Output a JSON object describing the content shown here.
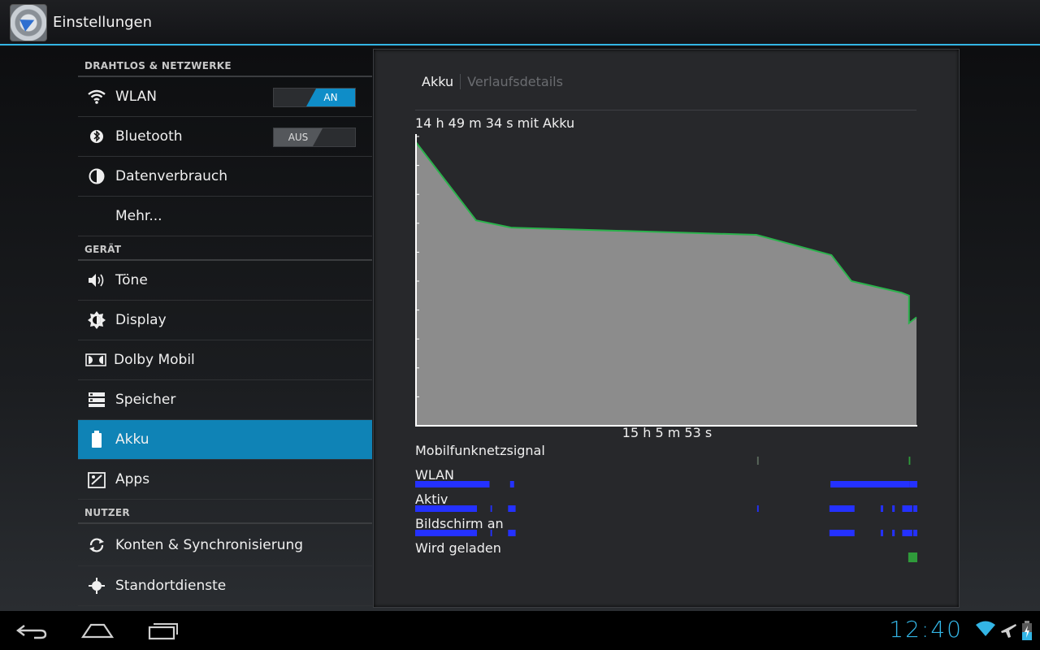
{
  "app": {
    "title": "Einstellungen",
    "icon": "settings-app-icon"
  },
  "sidebar": {
    "sections": [
      {
        "header": "DRAHTLOS & NETZWERKE",
        "items": [
          {
            "label": "WLAN",
            "icon": "wifi-icon",
            "toggle": "AN"
          },
          {
            "label": "Bluetooth",
            "icon": "bluetooth-icon",
            "toggle": "AUS"
          },
          {
            "label": "Datenverbrauch",
            "icon": "data-usage-icon"
          },
          {
            "label": "Mehr...",
            "icon": ""
          }
        ]
      },
      {
        "header": "GERÄT",
        "items": [
          {
            "label": "Töne",
            "icon": "speaker-icon"
          },
          {
            "label": "Display",
            "icon": "brightness-icon"
          },
          {
            "label": "Dolby Mobil",
            "icon": "dolby-icon"
          },
          {
            "label": "Speicher",
            "icon": "storage-icon"
          },
          {
            "label": "Akku",
            "icon": "battery-icon",
            "selected": true
          },
          {
            "label": "Apps",
            "icon": "apps-icon"
          }
        ]
      },
      {
        "header": "NUTZER",
        "items": [
          {
            "label": "Konten & Synchronisierung",
            "icon": "sync-icon"
          },
          {
            "label": "Standortdienste",
            "icon": "location-icon"
          }
        ]
      }
    ]
  },
  "panel": {
    "tabs": [
      "Akku",
      "Verlaufsdetails"
    ],
    "duration": "14 h 49 m 34 s mit Akku",
    "center_time": "15 h 5 m 53 s",
    "activity_rows": [
      "Mobilfunknetzsignal",
      "WLAN",
      "Aktiv",
      "Bildschirm an",
      "Wird geladen"
    ]
  },
  "chart_data": {
    "type": "area",
    "x": [
      0,
      0.12,
      0.19,
      0.68,
      0.83,
      0.87,
      0.97,
      0.985,
      0.985,
      1.0
    ],
    "y": [
      98,
      71,
      68.5,
      66,
      59,
      50,
      46,
      45,
      35.5,
      37.5
    ],
    "ylim": [
      0,
      100
    ],
    "xlim": [
      0,
      1
    ],
    "fill_color": "#8c8c8c",
    "line_color": "#2bb24c",
    "activity": {
      "Mobilfunknetzsignal": [
        [
          0.681,
          0.684
        ],
        [
          0.983,
          0.986
        ]
      ],
      "WLAN": [
        [
          0.0,
          0.148
        ],
        [
          0.189,
          0.197
        ],
        [
          0.827,
          0.985
        ],
        [
          0.985,
          1.0
        ]
      ],
      "Aktiv": [
        [
          0.0,
          0.123
        ],
        [
          0.15,
          0.153
        ],
        [
          0.185,
          0.2
        ],
        [
          0.681,
          0.684
        ],
        [
          0.825,
          0.875
        ],
        [
          0.927,
          0.932
        ],
        [
          0.95,
          0.955
        ],
        [
          0.97,
          0.99
        ],
        [
          0.992,
          1.0
        ]
      ],
      "Bildschirm an": [
        [
          0.0,
          0.123
        ],
        [
          0.15,
          0.153
        ],
        [
          0.185,
          0.2
        ],
        [
          0.825,
          0.875
        ],
        [
          0.927,
          0.932
        ],
        [
          0.95,
          0.955
        ],
        [
          0.97,
          0.99
        ],
        [
          0.992,
          1.0
        ]
      ],
      "Wird geladen": [
        [
          0.982,
          1.0
        ]
      ]
    },
    "activity_color": "#2431ff",
    "charging_color": "#2f9a3a"
  },
  "status": {
    "clock": "12:40"
  },
  "nav": {
    "back": "back-icon",
    "home": "home-icon",
    "recents": "recents-icon"
  }
}
